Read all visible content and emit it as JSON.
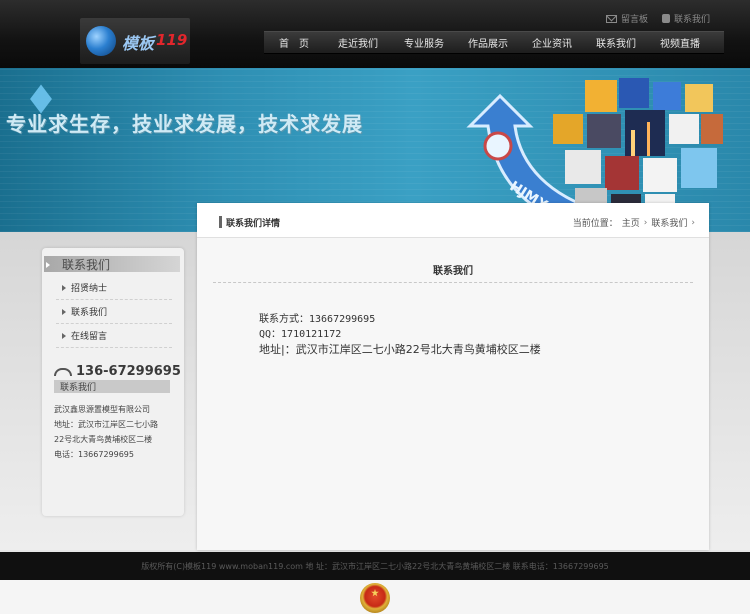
{
  "header": {
    "logo_text": "模板",
    "logo_num": "119",
    "top_links": [
      {
        "label": "留言板",
        "icon": "mail-icon"
      },
      {
        "label": "联系我们",
        "icon": "phone-icon"
      }
    ],
    "nav": [
      "首　页",
      "走近我们",
      "专业服务",
      "作品展示",
      "企业资讯",
      "联系我们",
      "视频直播"
    ]
  },
  "banner": {
    "slogan": "专业求生存，技业求发展，技术求发展",
    "arrow_text": "HJMX",
    "colors": {
      "sky": "#2e8fb3",
      "arrow": "#3a7fd0"
    }
  },
  "sidebar": {
    "title": "联系我们",
    "menu": [
      "招贤纳士",
      "联系我们",
      "在线留言"
    ],
    "phone": "136-67299695",
    "contact_title": "联系我们",
    "contact_lines": [
      "武汉鑫思源置模型有限公司",
      "地址：武汉市江岸区二七小路",
      "22号北大青鸟黄埔校区二楼",
      "电话：13667299695"
    ]
  },
  "main": {
    "head_title": "联系我们详情",
    "crumb": {
      "label": "当前位置：",
      "home": "主页",
      "current": "联系我们"
    },
    "title": "联系我们",
    "lines": [
      "联系方式：13667299695",
      "QQ：1710121172",
      "地址|：武汉市江岸区二七小路22号北大青鸟黄埔校区二楼"
    ]
  },
  "footer": {
    "text": "版权所有(C)模板119 www.moban119.com 地 址：武汉市江岸区二七小路22号北大青鸟黄埔校区二楼 联系电话：13667299695"
  }
}
